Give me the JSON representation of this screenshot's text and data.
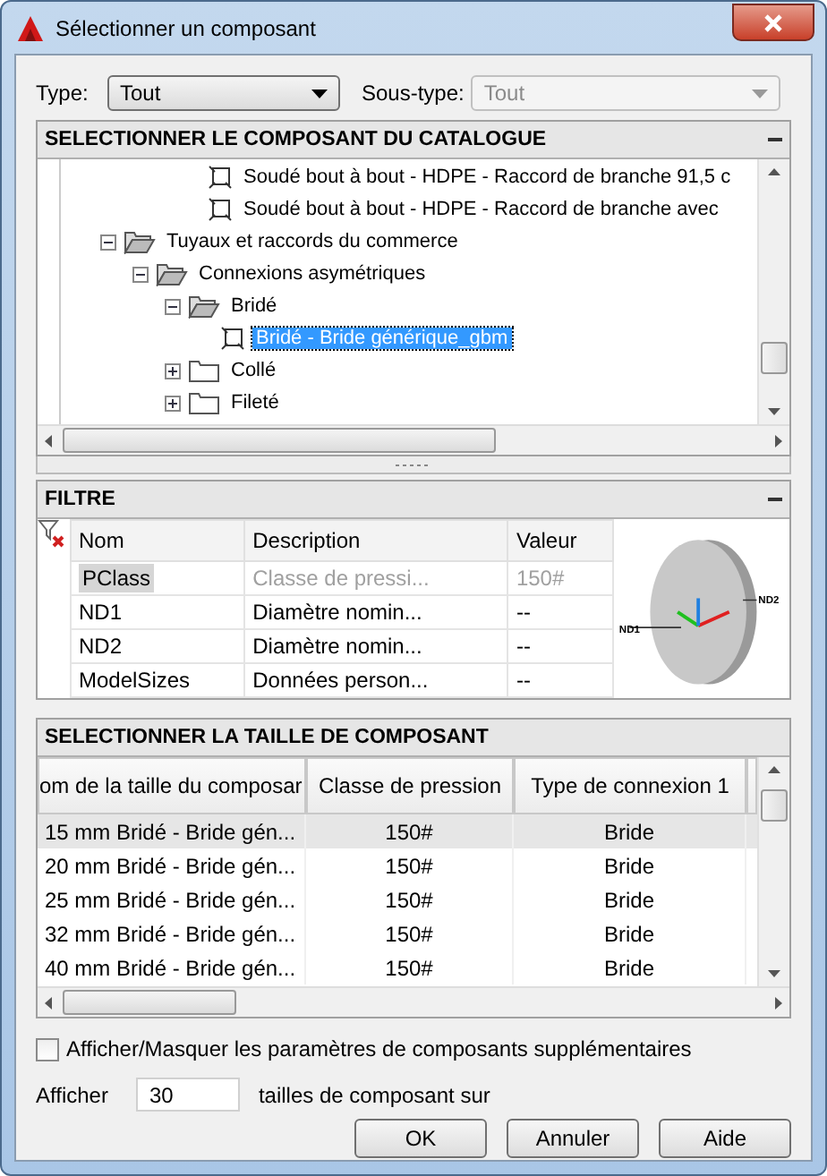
{
  "window": {
    "title": "Sélectionner un composant"
  },
  "type_field": {
    "label": "Type:",
    "value": "Tout"
  },
  "subtype_field": {
    "label": "Sous-type:",
    "value": "Tout",
    "disabled": true
  },
  "catalog": {
    "title": "SELECTIONNER LE COMPOSANT DU CATALOGUE",
    "leaves_above": [
      {
        "label": "Soudé bout à bout - HDPE - Raccord de branche 91,5 c"
      },
      {
        "label": "Soudé bout à bout - HDPE - Raccord de branche avec"
      }
    ],
    "nodes": [
      {
        "label": "Tuyaux et raccords du commerce",
        "expanded": true,
        "children": [
          {
            "label": "Connexions asymétriques",
            "expanded": true,
            "children": [
              {
                "label": "Bridé",
                "expanded": true,
                "children": [
                  {
                    "label": "Bridé - Bride générique_gbm",
                    "kind": "component",
                    "selected": true
                  }
                ]
              },
              {
                "label": "Collé",
                "expanded": false
              },
              {
                "label": "Fileté",
                "expanded": false
              }
            ]
          }
        ]
      }
    ]
  },
  "filter": {
    "title": "FILTRE",
    "columns": [
      "Nom",
      "Description",
      "Valeur"
    ],
    "rows": [
      {
        "cells": [
          "PClass",
          "Classe de pressi...",
          "150#"
        ],
        "disabled": true
      },
      {
        "cells": [
          "ND1",
          "Diamètre nomin...",
          "--"
        ],
        "disabled": false
      },
      {
        "cells": [
          "ND2",
          "Diamètre nomin...",
          "--"
        ],
        "disabled": false
      },
      {
        "cells": [
          "ModelSizes",
          "Données person...",
          "--"
        ],
        "disabled": false
      }
    ],
    "preview_labels": [
      "ND1",
      "ND2"
    ]
  },
  "sizes": {
    "title": "SELECTIONNER LA TAILLE DE COMPOSANT",
    "columns": [
      "om de la taille du composar",
      "Classe de pression",
      "Type de connexion 1"
    ],
    "rows": [
      {
        "cells": [
          "15 mm Bridé - Bride gén...",
          "150#",
          "Bride"
        ],
        "selected": true
      },
      {
        "cells": [
          "20 mm Bridé - Bride gén...",
          "150#",
          "Bride"
        ],
        "selected": false
      },
      {
        "cells": [
          "25 mm Bridé - Bride gén...",
          "150#",
          "Bride"
        ],
        "selected": false
      },
      {
        "cells": [
          "32 mm Bridé - Bride gén...",
          "150#",
          "Bride"
        ],
        "selected": false
      },
      {
        "cells": [
          "40 mm Bridé - Bride gén...",
          "150#",
          "Bride"
        ],
        "selected": false
      }
    ]
  },
  "toggle": {
    "label": "Afficher/Masquer les paramètres de composants supplémentaires",
    "checked": false
  },
  "count": {
    "label": "Afficher",
    "value": "30",
    "suffix": "tailles de composant sur"
  },
  "buttons": [
    "OK",
    "Annuler",
    "Aide"
  ]
}
